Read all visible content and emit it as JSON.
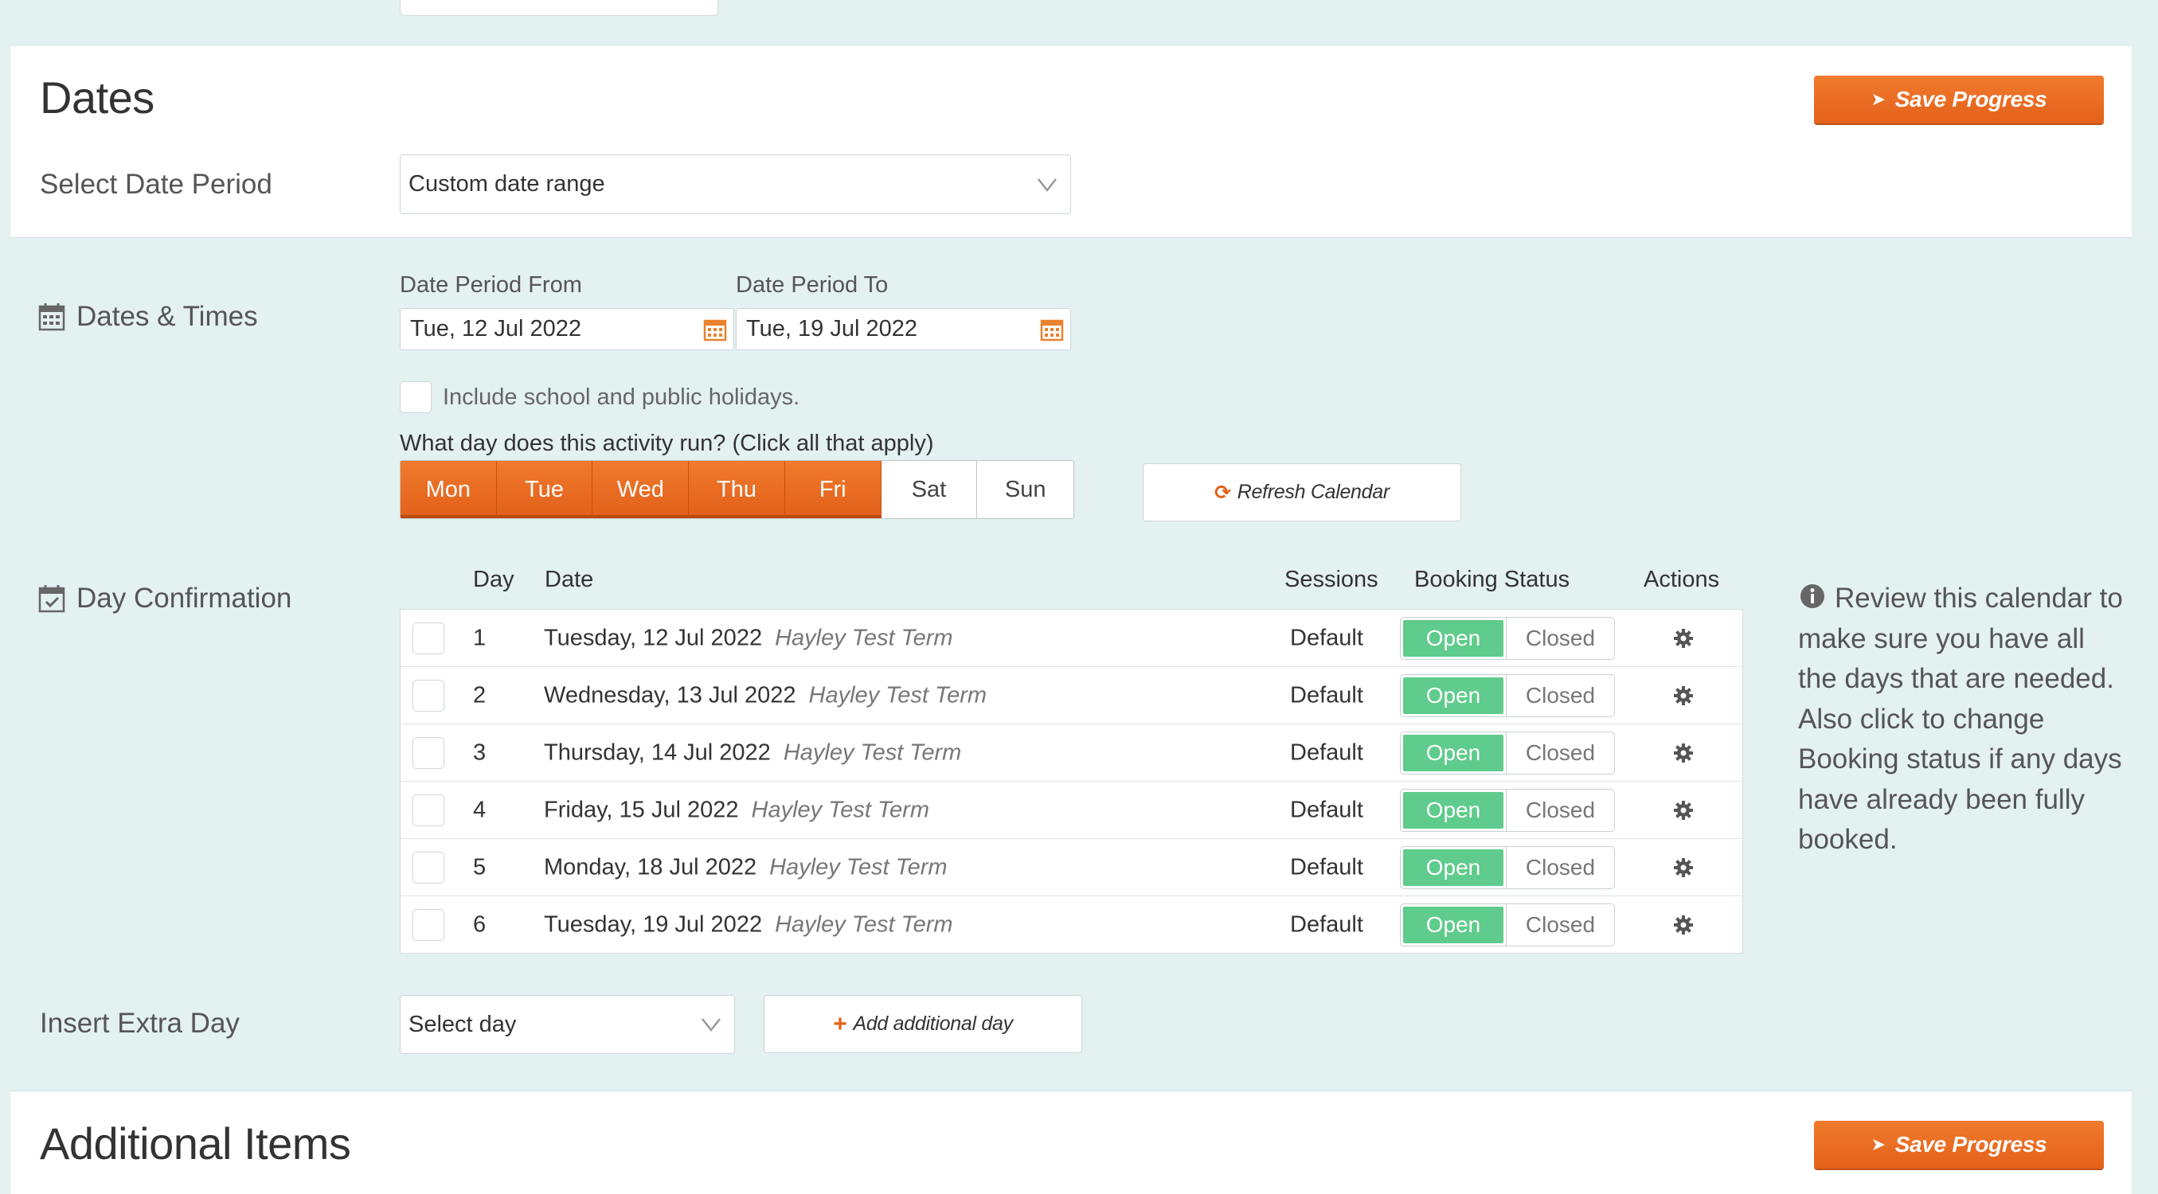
{
  "sections": {
    "dates_title": "Dates",
    "additional_title": "Additional Items"
  },
  "save_button": {
    "label": "Save Progress"
  },
  "date_period": {
    "label": "Select Date Period",
    "selected": "Custom date range"
  },
  "dates_times": {
    "label": "Dates & Times",
    "from_label": "Date Period From",
    "from_value": "Tue, 12 Jul 2022",
    "to_label": "Date Period To",
    "to_value": "Tue, 19 Jul 2022",
    "holidays_label": "Include school and public holidays.",
    "holidays_checked": false,
    "weekday_question": "What day does this activity run? (Click all that apply)",
    "weekdays": [
      {
        "label": "Mon",
        "selected": true
      },
      {
        "label": "Tue",
        "selected": true
      },
      {
        "label": "Wed",
        "selected": true
      },
      {
        "label": "Thu",
        "selected": true
      },
      {
        "label": "Fri",
        "selected": true
      },
      {
        "label": "Sat",
        "selected": false
      },
      {
        "label": "Sun",
        "selected": false
      }
    ],
    "refresh_label": "Refresh Calendar"
  },
  "day_confirmation": {
    "label": "Day Confirmation",
    "columns": {
      "day": "Day",
      "date": "Date",
      "sessions": "Sessions",
      "booking_status": "Booking Status",
      "actions": "Actions"
    },
    "rows": [
      {
        "day": "1",
        "date": "Tuesday, 12 Jul 2022",
        "term": "Hayley Test Term",
        "sessions": "Default",
        "open": "Open",
        "closed": "Closed"
      },
      {
        "day": "2",
        "date": "Wednesday, 13 Jul 2022",
        "term": "Hayley Test Term",
        "sessions": "Default",
        "open": "Open",
        "closed": "Closed"
      },
      {
        "day": "3",
        "date": "Thursday, 14 Jul 2022",
        "term": "Hayley Test Term",
        "sessions": "Default",
        "open": "Open",
        "closed": "Closed"
      },
      {
        "day": "4",
        "date": "Friday, 15 Jul 2022",
        "term": "Hayley Test Term",
        "sessions": "Default",
        "open": "Open",
        "closed": "Closed"
      },
      {
        "day": "5",
        "date": "Monday, 18 Jul 2022",
        "term": "Hayley Test Term",
        "sessions": "Default",
        "open": "Open",
        "closed": "Closed"
      },
      {
        "day": "6",
        "date": "Tuesday, 19 Jul 2022",
        "term": "Hayley Test Term",
        "sessions": "Default",
        "open": "Open",
        "closed": "Closed"
      }
    ],
    "info": "Review this calendar to make sure you have all the days that are needed. Also click to change Booking status if any days have already been fully booked."
  },
  "extra_day": {
    "label": "Insert Extra Day",
    "select_value": "Select day",
    "add_label": "Add additional day"
  },
  "colors": {
    "accent_orange": "#e86a22",
    "open_green": "#5fcb8c",
    "background_teal": "#e3f1f0"
  },
  "icons": {
    "save": "arrow-right-icon",
    "calendar": "calendar-icon",
    "day_confirmation": "calendar-check-icon",
    "refresh": "refresh-icon",
    "add": "plus-icon",
    "actions": "gear-icon",
    "info": "info-circle-icon"
  }
}
